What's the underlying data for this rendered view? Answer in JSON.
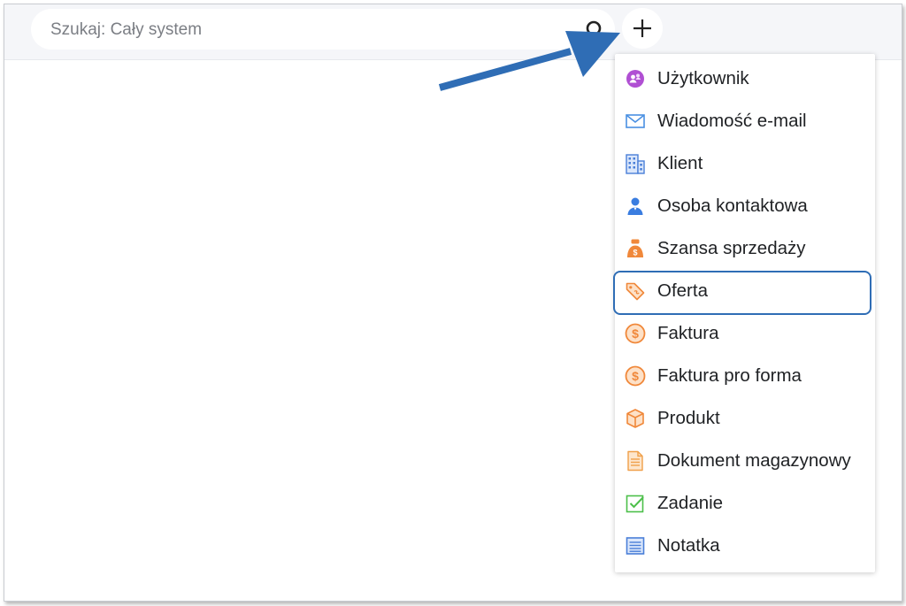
{
  "search": {
    "placeholder": "Szukaj: Cały system"
  },
  "add_button": {
    "icon": "plus-icon"
  },
  "menu": {
    "items": [
      {
        "id": "uzytkownik",
        "label": "Użytkownik",
        "icon": "user-badge-icon",
        "color": "#b04fd3"
      },
      {
        "id": "wiadomosc",
        "label": "Wiadomość e-mail",
        "icon": "envelope-icon",
        "color": "#4a90e2"
      },
      {
        "id": "klient",
        "label": "Klient",
        "icon": "building-icon",
        "color": "#4a7fd8"
      },
      {
        "id": "osoba",
        "label": "Osoba kontaktowa",
        "icon": "person-icon",
        "color": "#3a7de0"
      },
      {
        "id": "szansa",
        "label": "Szansa sprzedaży",
        "icon": "money-bag-icon",
        "color": "#f0883a"
      },
      {
        "id": "oferta",
        "label": "Oferta",
        "icon": "price-tag-icon",
        "color": "#f0883a"
      },
      {
        "id": "faktura",
        "label": "Faktura",
        "icon": "dollar-coin-icon",
        "color": "#f0883a"
      },
      {
        "id": "faktura-pro-forma",
        "label": "Faktura pro forma",
        "icon": "dollar-coin-icon",
        "color": "#f0883a"
      },
      {
        "id": "produkt",
        "label": "Produkt",
        "icon": "box-icon",
        "color": "#f0883a"
      },
      {
        "id": "dokument",
        "label": "Dokument magazynowy",
        "icon": "document-icon",
        "color": "#f0a04a"
      },
      {
        "id": "zadanie",
        "label": "Zadanie",
        "icon": "checkbox-icon",
        "color": "#4cbf4a"
      },
      {
        "id": "notatka",
        "label": "Notatka",
        "icon": "note-icon",
        "color": "#4a7fd8"
      }
    ],
    "highlighted": "Oferta"
  },
  "colors": {
    "highlight": "#2f6db5",
    "arrow": "#2f6db5",
    "topbar_bg": "#f5f6f9"
  }
}
